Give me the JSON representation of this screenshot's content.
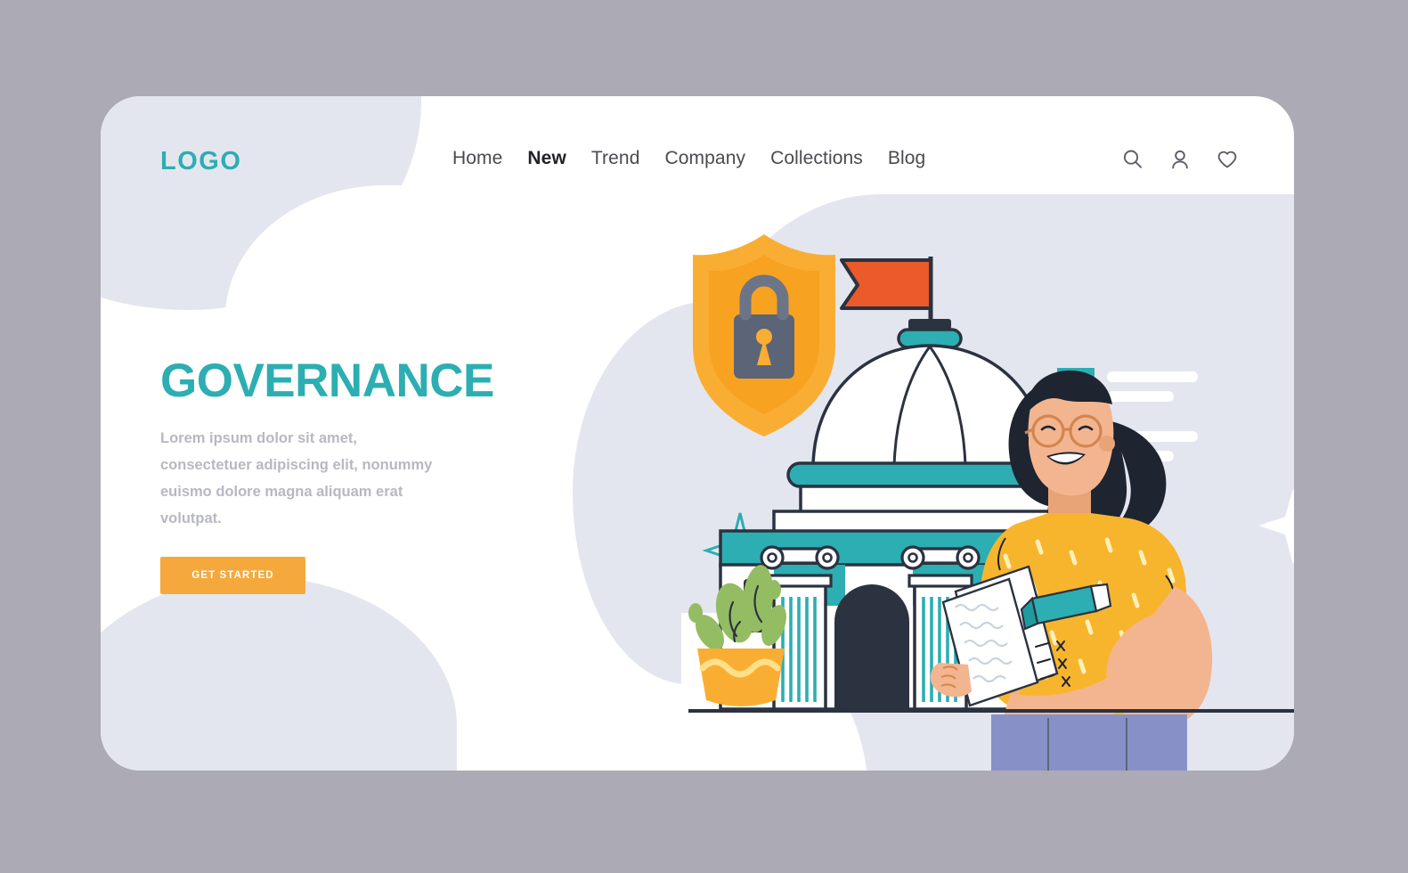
{
  "palette": {
    "page_background": "#ABAAB5",
    "card_background": "#FFFFFF",
    "blob": "#E4E6EF",
    "teal": "#2CAEB2",
    "teal_dark": "#1F9BA0",
    "amber": "#F5A93C",
    "amber_deep": "#F39C23",
    "orange_flag": "#EA5A2B",
    "navy": "#2B3240",
    "slate": "#5C6478",
    "skin": "#F3B58F",
    "hair": "#1E2430",
    "shirt_yellow": "#F7B52E",
    "pants_blue": "#8791C8",
    "plant_green": "#94BC62",
    "text_dark": "#4A4A50",
    "text_muted": "#B7B8C2"
  },
  "header": {
    "logo": "LOGO",
    "nav": [
      {
        "label": "Home",
        "active": false
      },
      {
        "label": "New",
        "active": true
      },
      {
        "label": "Trend",
        "active": false
      },
      {
        "label": "Company",
        "active": false
      },
      {
        "label": "Collections",
        "active": false
      },
      {
        "label": "Blog",
        "active": false
      }
    ],
    "icons": [
      {
        "name": "search-icon",
        "glyph": "search"
      },
      {
        "name": "user-icon",
        "glyph": "user"
      },
      {
        "name": "heart-icon",
        "glyph": "heart"
      }
    ]
  },
  "hero": {
    "headline": "GOVERNANCE",
    "subtext": "Lorem ipsum dolor sit amet, consectetuer adipiscing elit, nonummy euismo dolore magna aliquam erat volutpat.",
    "cta_label": "GET STARTED"
  },
  "illustration": {
    "description": "Flat vector scene: government capitol building with domed roof and orange flag, gold shield with padlock, woman in yellow polka-dot shirt holding documents and a teal pen, potted plant, checklist card and sparkles",
    "elements": [
      "shield-lock-icon",
      "capitol-building",
      "dome-flag",
      "checklist-card",
      "woman-character",
      "potted-plant",
      "sparkle-yellow",
      "sparkle-teal",
      "sparkle-white"
    ],
    "checklist": [
      {
        "checked": true,
        "lines": 2
      },
      {
        "checked": true,
        "lines": 2
      }
    ]
  }
}
